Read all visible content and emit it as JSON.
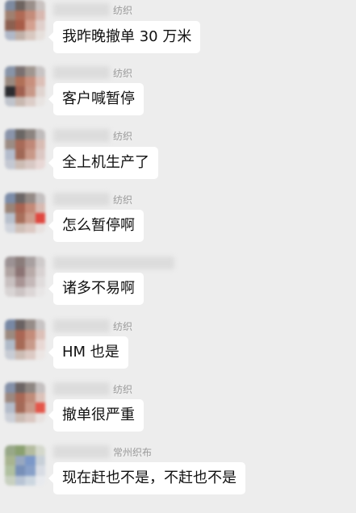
{
  "chat": {
    "messages": [
      {
        "sender": "纺织",
        "text": "我昨晚撤单 30 万米",
        "avatar_colors": [
          "#7d8aa0",
          "#6e6460",
          "#9a8f8a",
          "#c9c2c0",
          "#a08070",
          "#b06a55",
          "#c48c7a",
          "#d8b8b0",
          "#8c6050",
          "#a85c48",
          "#d4a090",
          "#e0d0cc",
          "#b0b8c8",
          "#c0b0a8",
          "#d8c8c0",
          "#e6e0dc"
        ]
      },
      {
        "sender": "纺织",
        "text": "客户喊暂停",
        "avatar_colors": [
          "#8894a8",
          "#7a7070",
          "#a09690",
          "#c8c4c4",
          "#9a8a80",
          "#b07058",
          "#c8907e",
          "#dcc0b8",
          "#2c2c30",
          "#a06050",
          "#c89888",
          "#e0d4d0",
          "#c0c4cc",
          "#c8b8b0",
          "#dccdc8",
          "#e8e4e2"
        ]
      },
      {
        "sender": "纺织",
        "text": "全上机生产了",
        "avatar_colors": [
          "#8a94aa",
          "#6a6664",
          "#8c8480",
          "#c0bcbc",
          "#9c8c84",
          "#a86a58",
          "#c08878",
          "#d8bcb4",
          "#b4bccc",
          "#a06856",
          "#c89888",
          "#dcc8c4",
          "#c4c8d2",
          "#ccbcb4",
          "#d8c8c4",
          "#e8d8d6"
        ]
      },
      {
        "sender": "纺织",
        "text": "怎么暂停啊",
        "avatar_colors": [
          "#7c8ca8",
          "#6c6666",
          "#948a86",
          "#c4c0c0",
          "#9a8478",
          "#a86452",
          "#c48a78",
          "#d8bab2",
          "#b8c0cc",
          "#a8705c",
          "#cc9c8c",
          "#e04840",
          "#d0d4dc",
          "#d0c0b8",
          "#dccac4",
          "#e8e2e0"
        ]
      },
      {
        "sender": "",
        "text": "诸多不易啊",
        "avatar_colors": [
          "#9c9294",
          "#8a7c7a",
          "#a8a0a0",
          "#cfcbcb",
          "#b0a4a2",
          "#8c7474",
          "#b8aaa8",
          "#d8d2d2",
          "#c8c0c0",
          "#a89494",
          "#c4b8b8",
          "#e0dcdc",
          "#d8d4d4",
          "#ccc4c4",
          "#dcd6d6",
          "#e8e6e6"
        ]
      },
      {
        "sender": "纺织",
        "text": "HM 也是",
        "avatar_colors": [
          "#7888a4",
          "#6a6262",
          "#968c88",
          "#c8c4c4",
          "#9c8a80",
          "#aa6654",
          "#c48c7a",
          "#dcc0b8",
          "#b0bac8",
          "#a66a56",
          "#c89a8a",
          "#e8d8d4",
          "#c8ccd4",
          "#ccbcb4",
          "#dccac4",
          "#ece6e4"
        ]
      },
      {
        "sender": "纺织",
        "text": "撤单很严重",
        "avatar_colors": [
          "#8490a8",
          "#6c6464",
          "#8e8682",
          "#c4c0c0",
          "#9c8880",
          "#a86856",
          "#c08c7a",
          "#dcc2ba",
          "#b4bcca",
          "#a46a58",
          "#c89888",
          "#e4564a",
          "#ccd0d8",
          "#ccbcb4",
          "#dac8c2",
          "#e8e2e0"
        ]
      },
      {
        "sender": "常州织布",
        "text": "现在赶也不是，不赶也不是",
        "avatar_colors": [
          "#98a888",
          "#8aa070",
          "#b4bca0",
          "#d4d8cc",
          "#a8b490",
          "#98a8c0",
          "#7c98c8",
          "#c8d0d8",
          "#b0c0a0",
          "#7890b8",
          "#88a0c8",
          "#d8dce4",
          "#c8d0c0",
          "#b8c4d4",
          "#ccd6e0",
          "#e8eaee"
        ]
      }
    ]
  }
}
